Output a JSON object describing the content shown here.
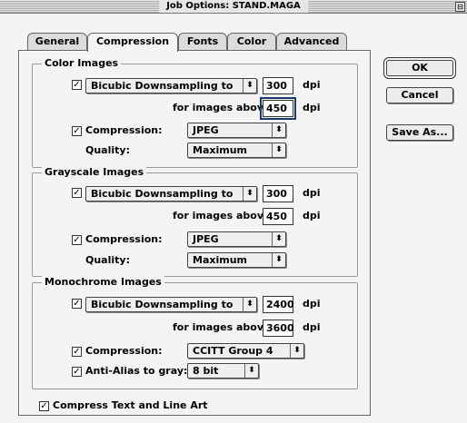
{
  "window": {
    "title": "Job Options: STAND.MAGA",
    "zoom_glyph": "⊟"
  },
  "tabs": [
    {
      "label": "General",
      "active": false
    },
    {
      "label": "Compression",
      "active": true
    },
    {
      "label": "Fonts",
      "active": false
    },
    {
      "label": "Color",
      "active": false
    },
    {
      "label": "Advanced",
      "active": false
    }
  ],
  "buttons": {
    "ok": "OK",
    "cancel": "Cancel",
    "save_as": "Save As..."
  },
  "color_images": {
    "title": "Color Images",
    "downsample_checked": true,
    "downsample_method": "Bicubic Downsampling to",
    "resolution": "300",
    "resolution_unit": "dpi",
    "above_label": "for images above:",
    "above_value": "450",
    "above_unit": "dpi",
    "compression_checked": true,
    "compression_label": "Compression:",
    "compression_value": "JPEG",
    "quality_label": "Quality:",
    "quality_value": "Maximum"
  },
  "grayscale_images": {
    "title": "Grayscale Images",
    "downsample_checked": true,
    "downsample_method": "Bicubic Downsampling to",
    "resolution": "300",
    "resolution_unit": "dpi",
    "above_label": "for images above:",
    "above_value": "450",
    "above_unit": "dpi",
    "compression_checked": true,
    "compression_label": "Compression:",
    "compression_value": "JPEG",
    "quality_label": "Quality:",
    "quality_value": "Maximum"
  },
  "monochrome_images": {
    "title": "Monochrome Images",
    "downsample_checked": true,
    "downsample_method": "Bicubic Downsampling to",
    "resolution": "2400",
    "resolution_unit": "dpi",
    "above_label": "for images above:",
    "above_value": "3600",
    "above_unit": "dpi",
    "compression_checked": true,
    "compression_label": "Compression:",
    "compression_value": "CCITT Group 4",
    "antialias_checked": true,
    "antialias_label": "Anti-Alias to gray:",
    "antialias_value": "8 bit"
  },
  "compress_text": {
    "checked": true,
    "label": "Compress Text and Line Art"
  },
  "glyphs": {
    "check": "✓",
    "popup_arrows": "⬍"
  }
}
